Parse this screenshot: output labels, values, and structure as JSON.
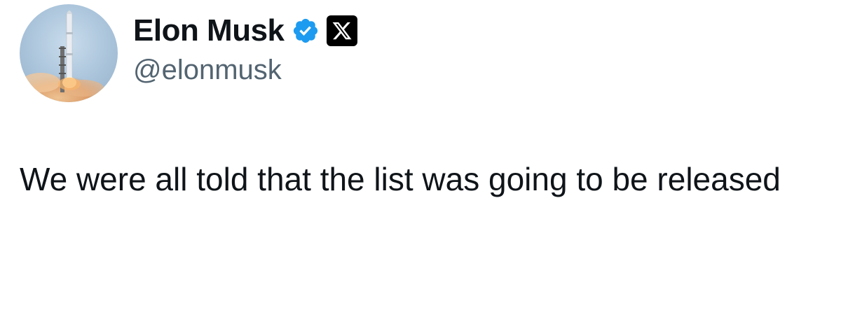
{
  "author": {
    "display_name": "Elon Musk",
    "handle": "@elonmusk",
    "verified": true,
    "badge_color": "#1d9bf0",
    "org_badge_icon": "x-logo-icon",
    "avatar_icon": "rocket-launch-avatar"
  },
  "tweet": {
    "text": "We were all told that the list was going to be released"
  },
  "colors": {
    "text_primary": "#0f1419",
    "text_secondary": "#536471",
    "background": "#ffffff"
  }
}
